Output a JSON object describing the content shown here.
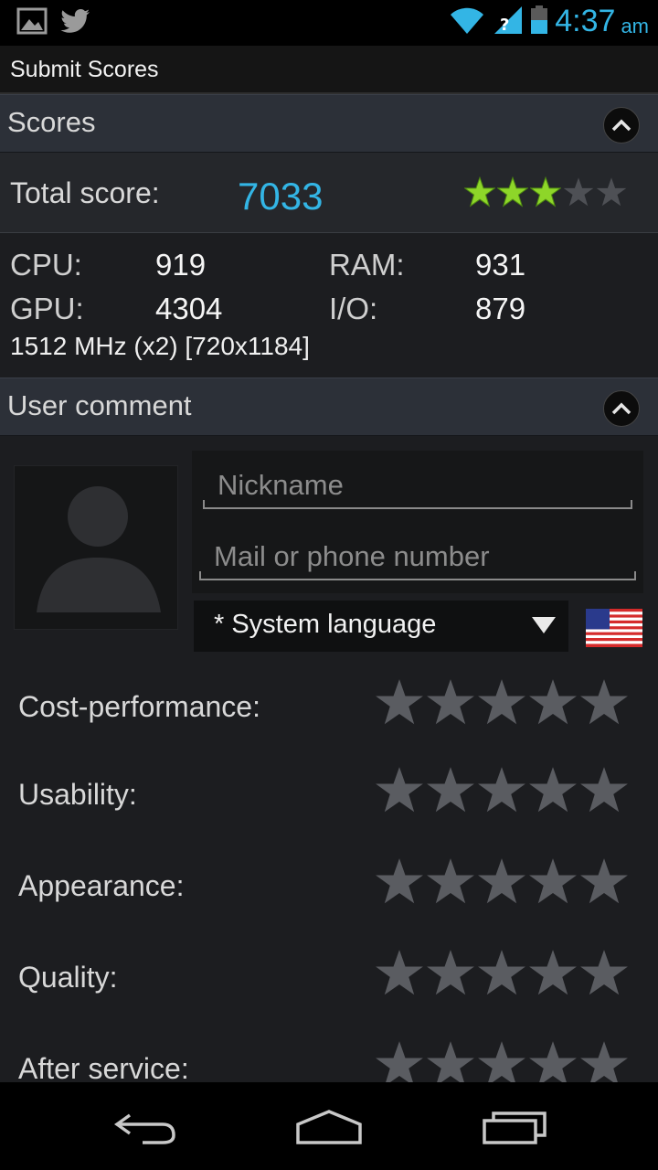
{
  "status_bar": {
    "time": "4:37",
    "ampm": "am",
    "icons": [
      "gallery-icon",
      "twitter-icon",
      "wifi-icon",
      "signal-icon",
      "battery-icon"
    ]
  },
  "title_bar": {
    "title": "Submit Scores"
  },
  "scores_section": {
    "header": "Scores",
    "total_label": "Total score:",
    "total_value": "7033",
    "total_stars": 3,
    "total_stars_max": 5,
    "cpu_label": "CPU:",
    "cpu_value": "919",
    "ram_label": "RAM:",
    "ram_value": "931",
    "gpu_label": "GPU:",
    "gpu_value": "4304",
    "io_label": "I/O:",
    "io_value": "879",
    "device_line": "1512 MHz (x2) [720x1184]"
  },
  "comment_section": {
    "header": "User comment",
    "nickname_placeholder": "Nickname",
    "contact_placeholder": "Mail or phone number",
    "language_value": "* System language",
    "ratings": [
      {
        "label": "Cost-performance:",
        "stars": 0
      },
      {
        "label": "Usability:",
        "stars": 0
      },
      {
        "label": "Appearance:",
        "stars": 0
      },
      {
        "label": "Quality:",
        "stars": 0
      },
      {
        "label": "After service:",
        "stars": 0
      }
    ]
  },
  "colors": {
    "accent": "#33b5e5",
    "star_active": "#8ed629",
    "star_inactive": "#5a5c61"
  }
}
